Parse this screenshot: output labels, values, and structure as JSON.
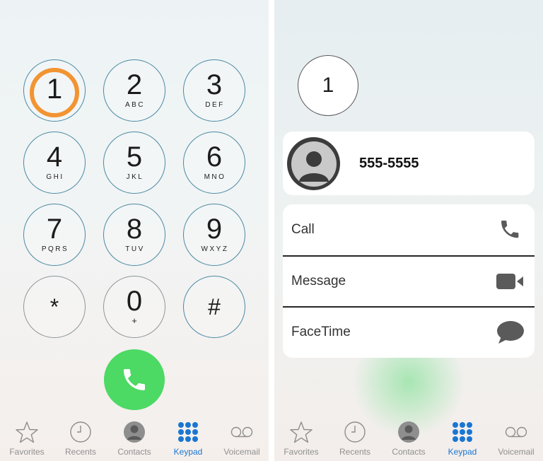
{
  "left_screen": {
    "keys": [
      {
        "digit": "1",
        "letters": ""
      },
      {
        "digit": "2",
        "letters": "ABC"
      },
      {
        "digit": "3",
        "letters": "DEF"
      },
      {
        "digit": "4",
        "letters": "GHI"
      },
      {
        "digit": "5",
        "letters": "JKL"
      },
      {
        "digit": "6",
        "letters": "MNO"
      },
      {
        "digit": "7",
        "letters": "PQRS"
      },
      {
        "digit": "8",
        "letters": "TUV"
      },
      {
        "digit": "9",
        "letters": "WXYZ"
      },
      {
        "digit": "*",
        "letters": ""
      },
      {
        "digit": "0",
        "letters": "+"
      },
      {
        "digit": "#",
        "letters": ""
      }
    ],
    "highlight_color": "#f29432",
    "call_button_color": "#4cd964"
  },
  "right_screen": {
    "entered_digit": "1",
    "contact_number": "555-5555",
    "actions": [
      {
        "label": "Call",
        "icon": "phone-icon"
      },
      {
        "label": "Message",
        "icon": "video-camera-icon"
      },
      {
        "label": "FaceTime",
        "icon": "speech-bubble-icon"
      }
    ]
  },
  "tabbar": {
    "items": [
      {
        "label": "Favorites",
        "icon": "star-icon"
      },
      {
        "label": "Recents",
        "icon": "clock-icon"
      },
      {
        "label": "Contacts",
        "icon": "person-icon"
      },
      {
        "label": "Keypad",
        "icon": "keypad-icon",
        "active": true
      },
      {
        "label": "Voicemail",
        "icon": "voicemail-icon"
      }
    ],
    "active_color": "#1a76d2",
    "inactive_color": "#909090"
  }
}
